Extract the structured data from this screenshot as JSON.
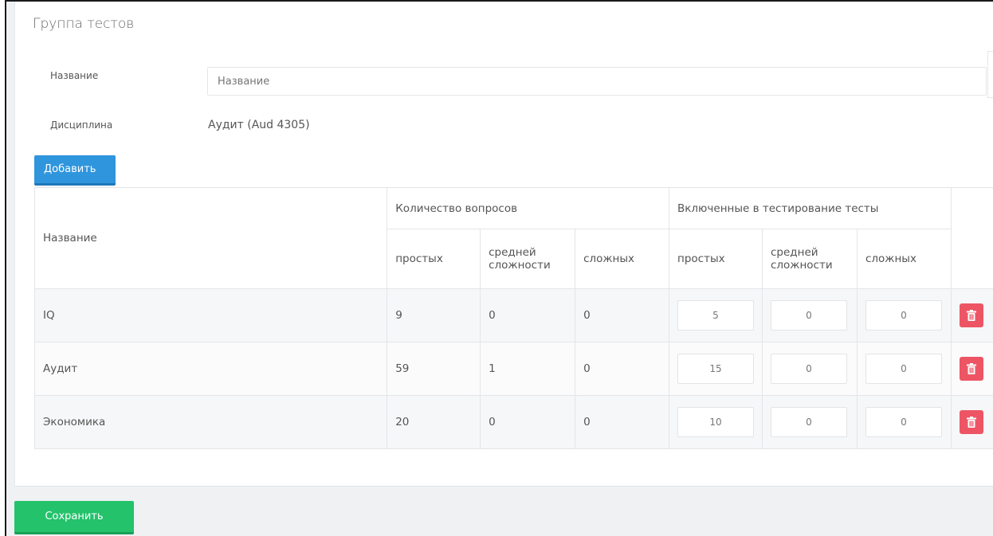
{
  "form": {
    "title": "Группа тестов",
    "name_label": "Название",
    "name_placeholder": "Название",
    "discipline_label": "Дисциплина",
    "discipline_value": "Аудит (Aud 4305)",
    "add_button": "Добавить",
    "save_button": "Сохранить"
  },
  "table": {
    "name_header": "Название",
    "group_questions": "Количество вопросов",
    "group_included": "Включенные в тестирование тесты",
    "sub_simple": "простых",
    "sub_medium": "средней сложности",
    "sub_hard": "сложных",
    "rows": [
      {
        "name": "IQ",
        "q_simple": "9",
        "q_medium": "0",
        "q_hard": "0",
        "i_simple": "5",
        "i_medium": "0",
        "i_hard": "0"
      },
      {
        "name": "Аудит",
        "q_simple": "59",
        "q_medium": "1",
        "q_hard": "0",
        "i_simple": "15",
        "i_medium": "0",
        "i_hard": "0"
      },
      {
        "name": "Экономика",
        "q_simple": "20",
        "q_medium": "0",
        "q_hard": "0",
        "i_simple": "10",
        "i_medium": "0",
        "i_hard": "0"
      }
    ]
  },
  "icons": {
    "delete": "trash-icon"
  },
  "colors": {
    "add_button": "#2f95dd",
    "save_button": "#23c26b",
    "delete_button": "#ed5565"
  }
}
